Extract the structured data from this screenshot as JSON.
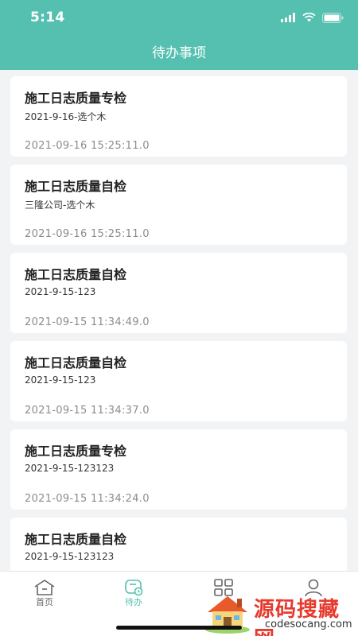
{
  "status": {
    "time": "5:14"
  },
  "header": {
    "title": "待办事项"
  },
  "items": [
    {
      "title": "施工日志质量专检",
      "subtitle": "2021-9-16-选个木",
      "time": "2021-09-16 15:25:11.0"
    },
    {
      "title": "施工日志质量自检",
      "subtitle": "三隆公司-选个木",
      "time": "2021-09-16 15:25:11.0"
    },
    {
      "title": "施工日志质量自检",
      "subtitle": "2021-9-15-123",
      "time": "2021-09-15 11:34:49.0"
    },
    {
      "title": "施工日志质量自检",
      "subtitle": "2021-9-15-123",
      "time": "2021-09-15 11:34:37.0"
    },
    {
      "title": "施工日志质量专检",
      "subtitle": "2021-9-15-123123",
      "time": "2021-09-15 11:34:24.0"
    },
    {
      "title": "施工日志质量自检",
      "subtitle": "2021-9-15-123123",
      "time": ""
    }
  ],
  "tabs": [
    {
      "label": "首页",
      "icon": "home-icon"
    },
    {
      "label": "待办",
      "icon": "todo-icon"
    },
    {
      "label": "",
      "icon": "grid-icon"
    },
    {
      "label": "",
      "icon": "user-icon"
    }
  ],
  "watermark": {
    "text": "源码搜藏网",
    "url": "codesocang.com"
  },
  "colors": {
    "primary": "#55c0b0",
    "background": "#f2f3f5",
    "watermark": "#e63a2e"
  }
}
